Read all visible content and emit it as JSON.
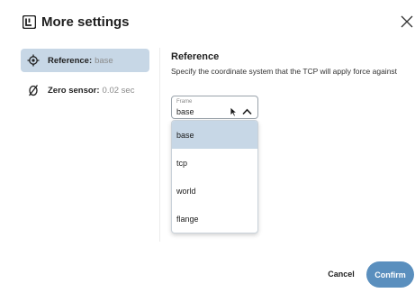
{
  "dialog": {
    "title": "More settings",
    "logo_icon": "ur-logo-icon",
    "close_icon": "close-icon"
  },
  "sidebar": {
    "items": [
      {
        "label": "Reference:",
        "value": "base",
        "icon": "crosshair-target-icon",
        "active": true
      },
      {
        "label": "Zero sensor:",
        "value": "0.02 sec",
        "icon": "zero-slash-icon",
        "active": false
      }
    ]
  },
  "main": {
    "section_title": "Reference",
    "description": "Specify the coordinate system that the TCP will apply force against",
    "frame_select": {
      "label": "Frame",
      "value": "base",
      "expanded": true,
      "options": [
        "base",
        "tcp",
        "world",
        "flange"
      ],
      "selected_index": 0
    }
  },
  "footer": {
    "cancel_label": "Cancel",
    "confirm_label": "Confirm"
  },
  "colors": {
    "accent": "#5a8fbe",
    "selected_bg": "#c7d7e6"
  }
}
